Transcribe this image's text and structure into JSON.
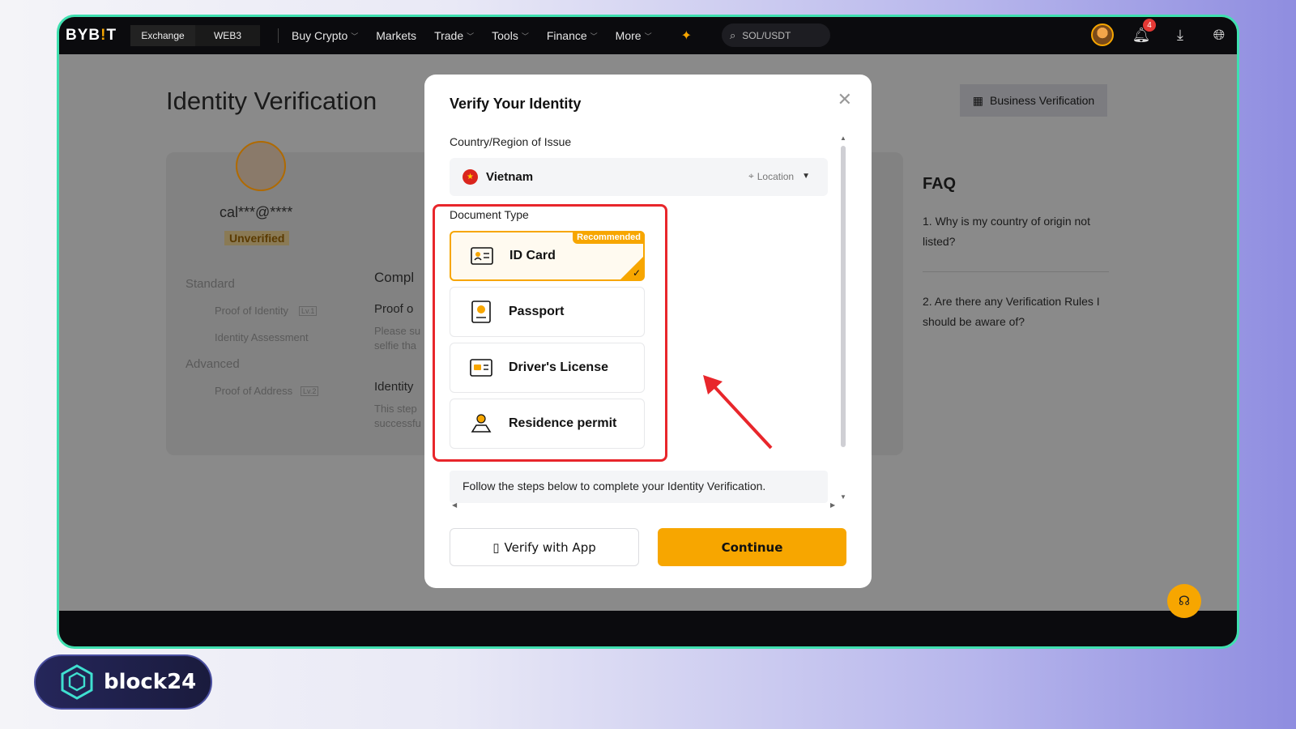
{
  "nav": {
    "logo_main": "BYB",
    "logo_accent": "!",
    "logo_end": "T",
    "tabs": [
      "Exchange",
      "WEB3"
    ],
    "items": [
      "Buy Crypto",
      "Markets",
      "Trade",
      "Tools",
      "Finance",
      "More"
    ],
    "search_placeholder": "SOL/USDT",
    "notification_count": "4"
  },
  "page": {
    "title": "Identity Verification",
    "business_button": "Business Verification",
    "username": "cal***@****",
    "status": "Unverified",
    "levels": {
      "standard": "Standard",
      "standard_items": [
        "Proof of Identity",
        "Identity Assessment"
      ],
      "advanced": "Advanced",
      "advanced_items": [
        "Proof of Address"
      ],
      "badge_lv1": "Lv.1",
      "badge_lv2": "Lv.2"
    },
    "main_headings": {
      "compl": "Compl",
      "proof": "Proof o",
      "please": "Please su",
      "selfie": "selfie tha",
      "identity": "Identity",
      "this_step": "This step",
      "successful": "successfu"
    },
    "faq_title": "FAQ",
    "faq": [
      "1. Why is my country of origin not listed?",
      "2. Are there any Verification Rules I should be aware of?"
    ]
  },
  "modal": {
    "title": "Verify Your Identity",
    "country_label": "Country/Region of Issue",
    "country": "Vietnam",
    "location_label": "Location",
    "document_type_label": "Document Type",
    "documents": [
      {
        "label": "ID Card",
        "tag": "Recommended",
        "selected": true
      },
      {
        "label": "Passport"
      },
      {
        "label": "Driver's License"
      },
      {
        "label": "Residence permit"
      }
    ],
    "info": "Follow the steps below to complete your Identity Verification.",
    "verify_app": "Verify with App",
    "continue": "Continue"
  },
  "brand": {
    "watermark": "block24"
  },
  "colors": {
    "accent": "#f7a600",
    "highlight": "#e8262b",
    "frame": "#3fe0b0"
  }
}
